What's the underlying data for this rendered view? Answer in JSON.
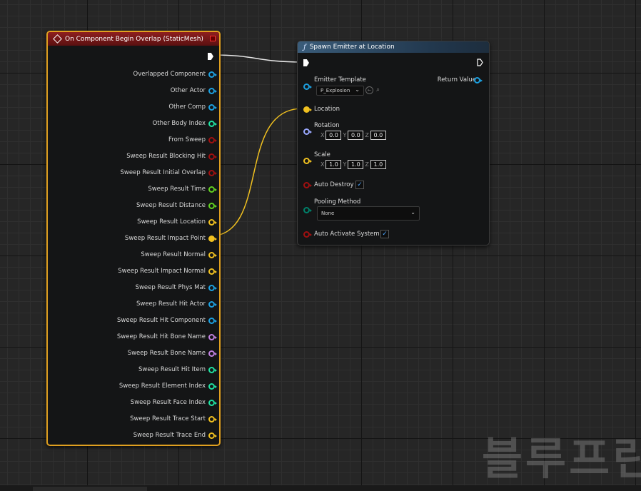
{
  "colors": {
    "exec": "#ffffff",
    "object": "#1ca0e0",
    "int": "#1fe0a0",
    "bool": "#a01010",
    "float": "#60d020",
    "vector": "#f0c020",
    "rotator": "#9aa8ff",
    "name": "#c080e0",
    "byte": "#00806a",
    "event_border": "#e0a020",
    "wire_vector": "#f0c020"
  },
  "event_node": {
    "title": "On Component Begin Overlap (StaticMesh)",
    "outputs": [
      {
        "label": "Overlapped Component",
        "type": "object"
      },
      {
        "label": "Other Actor",
        "type": "object"
      },
      {
        "label": "Other Comp",
        "type": "object"
      },
      {
        "label": "Other Body Index",
        "type": "int"
      },
      {
        "label": "From Sweep",
        "type": "bool"
      },
      {
        "label": "Sweep Result Blocking Hit",
        "type": "bool"
      },
      {
        "label": "Sweep Result Initial Overlap",
        "type": "bool"
      },
      {
        "label": "Sweep Result Time",
        "type": "float"
      },
      {
        "label": "Sweep Result Distance",
        "type": "float"
      },
      {
        "label": "Sweep Result Location",
        "type": "vector"
      },
      {
        "label": "Sweep Result Impact Point",
        "type": "vector",
        "connected": true
      },
      {
        "label": "Sweep Result Normal",
        "type": "vector"
      },
      {
        "label": "Sweep Result Impact Normal",
        "type": "vector"
      },
      {
        "label": "Sweep Result Phys Mat",
        "type": "object"
      },
      {
        "label": "Sweep Result Hit Actor",
        "type": "object"
      },
      {
        "label": "Sweep Result Hit Component",
        "type": "object"
      },
      {
        "label": "Sweep Result Hit Bone Name",
        "type": "name"
      },
      {
        "label": "Sweep Result Bone Name",
        "type": "name"
      },
      {
        "label": "Sweep Result Hit Item",
        "type": "int"
      },
      {
        "label": "Sweep Result Element Index",
        "type": "int"
      },
      {
        "label": "Sweep Result Face Index",
        "type": "int"
      },
      {
        "label": "Sweep Result Trace Start",
        "type": "vector"
      },
      {
        "label": "Sweep Result Trace End",
        "type": "vector"
      }
    ]
  },
  "spawn_node": {
    "title": "Spawn Emitter at Location",
    "emitter_template_label": "Emitter Template",
    "emitter_template_value": "P_Explosion",
    "return_value_label": "Return Value",
    "location_label": "Location",
    "rotation_label": "Rotation",
    "rotation": {
      "x": "0.0",
      "y": "0.0",
      "z": "0.0"
    },
    "scale_label": "Scale",
    "scale": {
      "x": "1.0",
      "y": "1.0",
      "z": "1.0"
    },
    "axis_x": "X",
    "axis_y": "Y",
    "axis_z": "Z",
    "auto_destroy_label": "Auto Destroy",
    "auto_destroy": true,
    "pooling_method_label": "Pooling Method",
    "pooling_method_value": "None",
    "auto_activate_label": "Auto Activate System",
    "auto_activate": true,
    "check_glyph": "✓",
    "chevron_glyph": "⌄"
  },
  "watermark": "블루프린"
}
